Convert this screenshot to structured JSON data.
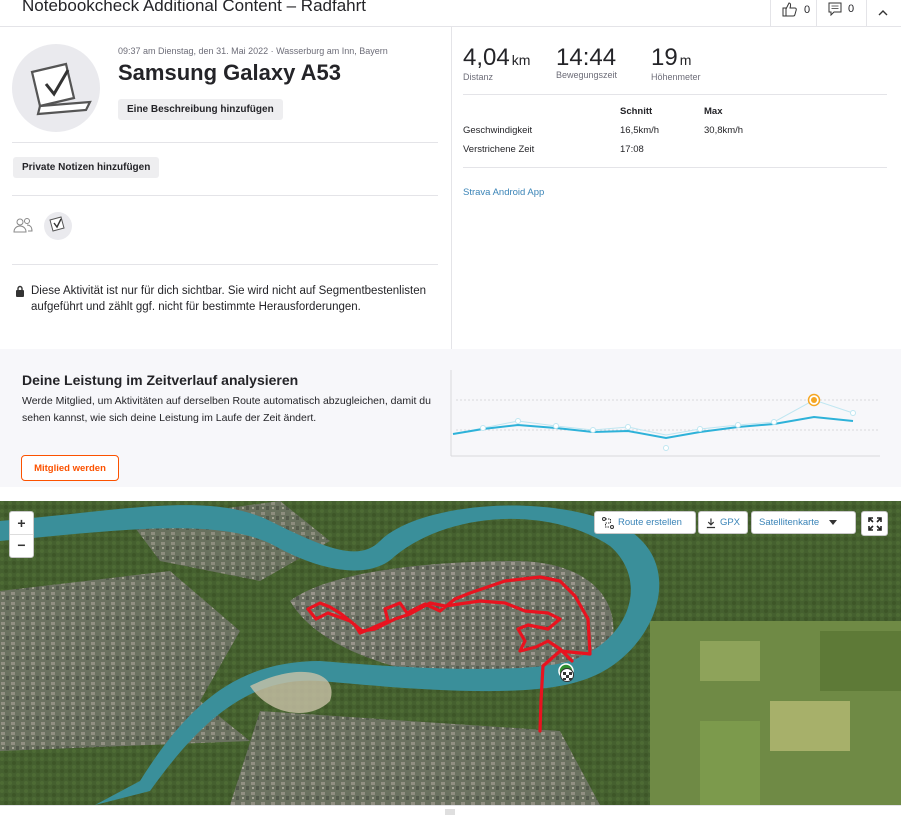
{
  "header": {
    "title": "Notebookcheck Additional Content – Radfahrt",
    "kudos_count": "0",
    "comments_count": "0"
  },
  "activity": {
    "datetime_location": "09:37 am Dienstag, den 31. Mai 2022 · Wasserburg am Inn, Bayern",
    "title": "Samsung Galaxy A53",
    "add_description_label": "Eine Beschreibung hinzufügen",
    "private_notes_label": "Private Notizen hinzufügen",
    "privacy_notice": "Diese Aktivität ist nur für dich sichtbar. Sie wird nicht auf Segmentbestenlisten aufgeführt und zählt ggf. nicht für bestimmte Herausforderungen."
  },
  "stats": {
    "distance": {
      "value": "4,04",
      "unit": "km",
      "label": "Distanz"
    },
    "moving_time": {
      "value": "14:44",
      "unit": "",
      "label": "Bewegungszeit"
    },
    "elevation": {
      "value": "19",
      "unit": "m",
      "label": "Höhenmeter"
    },
    "table": {
      "col_avg": "Schnitt",
      "col_max": "Max",
      "rows": [
        {
          "label": "Geschwindigkeit",
          "avg": "16,5km/h",
          "max": "30,8km/h"
        },
        {
          "label": "Verstrichene Zeit",
          "avg": "17:08",
          "max": ""
        }
      ]
    },
    "device_app": "Strava Android App"
  },
  "analyze": {
    "title": "Deine Leistung im Zeitverlauf analysieren",
    "text": "Werde Mitglied, um Aktivitäten auf derselben Route automatisch abzugleichen, damit du sehen kannst, wie sich deine Leistung im Laufe der Zeit ändert.",
    "cta_label": "Mitglied werden"
  },
  "map": {
    "zoom_in": "+",
    "zoom_out": "−",
    "route_create_label": "Route erstellen",
    "gpx_label": "GPX",
    "map_type_label": "Satellitenkarte"
  },
  "colors": {
    "accent": "#fc5200",
    "link": "#3a84b7",
    "route": "#e8131f",
    "trend_line": "#2eb2d9"
  }
}
